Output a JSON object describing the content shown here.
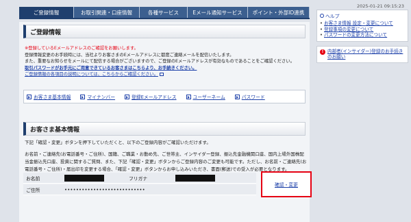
{
  "timestamp": "2025-01-21 09:15:23",
  "tabs": [
    "ご登録情報",
    "お取引関連・口座情報",
    "各種サービス",
    "Eメール通知サービス",
    "ポイント・外部ID連携"
  ],
  "page_title": "ご登録情報",
  "notice": {
    "warning": "※登録しているEメールアドレスのご確認をお願いします。",
    "line1": "登録情報変更のお手続時には、当社よりお客さまのEメールアドレスに都度ご連絡メールを配信いたします。",
    "line2": "また、重要なお知らせをメールにて配信する場合がございますので、ご登録のEメールアドレスが有効なものであることをご確認ください。",
    "link_password": "取引パスワードがお手元にご用意できているお客さまはこちらより、お手続きください。",
    "link_explain": "ご登録情報の各項目の説明については、こちらからご確認ください。"
  },
  "quick_links": [
    "お客さま基本情報",
    "マイナンバー",
    "登録Eメールアドレス",
    "ユーザーネーム",
    "パスワード"
  ],
  "basic_info": {
    "heading": "お客さま基本情報",
    "intro": "下記「確認・変更」ボタンを押下していただくと、以下のご登録内容がご確認いただけます。",
    "detail": "お名前・ご連絡先(お電話番号・ご住所)、国籍、ご職業・お勤め先、ご世帯主、インサイダー登録、振込先金融機関口座、国内上場外国株配当金振込先口座、投資に関するご質問、また、下記「確認・変更」ボタンからご登録内容のご変更も可能です。ただし、お名前・ご連絡先(お電話番号・ご住所)・届出印を変更する場合、「確認・変更」ボタンからお申し込みいただき、書面(郵送)での受入が必要となります。",
    "name_label": "お名前",
    "furigana_label": "フリガナ",
    "address_label": "ご住所",
    "address_masked": "••••••••••••••••••••••••••••",
    "confirm_button": "確認・変更"
  },
  "sidebar": {
    "help_title": "ヘルプ",
    "help_links": [
      "お客さま情報 設定・変更について",
      "登録事項の変更について",
      "パスワードの変更方法について"
    ],
    "insider_link": "内部者(インサイダー)登録のお手続きのお願い"
  }
}
